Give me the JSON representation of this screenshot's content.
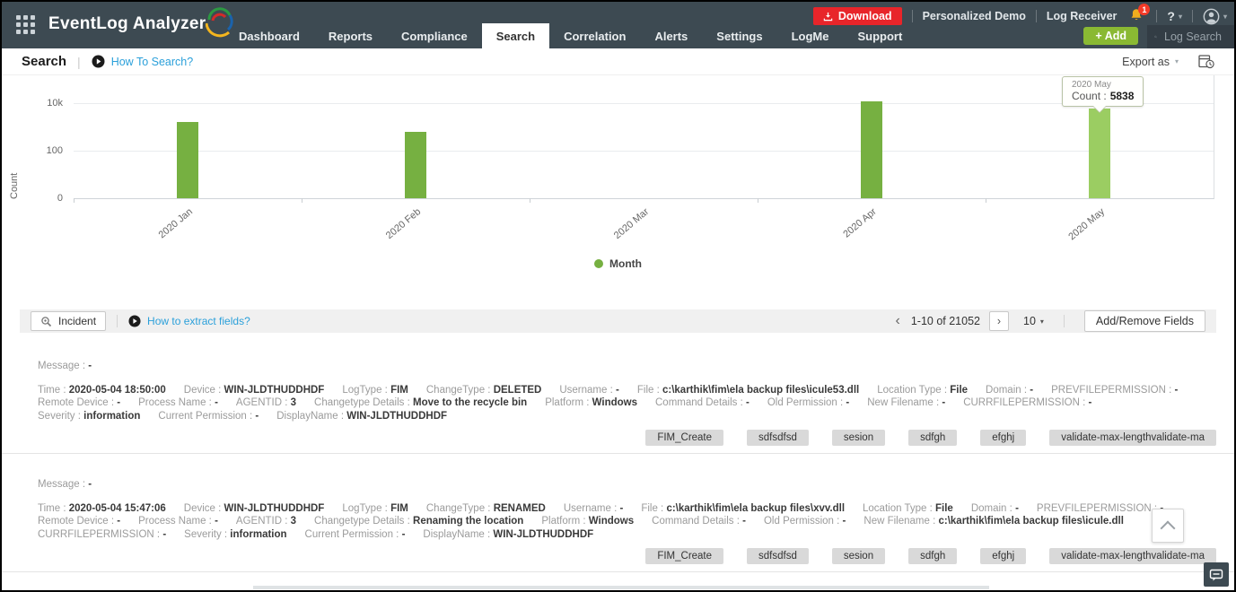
{
  "icons": {
    "chevron_down": "▾",
    "chevron_left": "‹",
    "chevron_right": "›"
  },
  "header": {
    "brand": "EventLog Analyzer",
    "nav": [
      {
        "label": "Dashboard",
        "active": false
      },
      {
        "label": "Reports",
        "active": false
      },
      {
        "label": "Compliance",
        "active": false
      },
      {
        "label": "Search",
        "active": true
      },
      {
        "label": "Correlation",
        "active": false
      },
      {
        "label": "Alerts",
        "active": false
      },
      {
        "label": "Settings",
        "active": false
      },
      {
        "label": "LogMe",
        "active": false
      },
      {
        "label": "Support",
        "active": false
      }
    ],
    "download_label": "Download",
    "personalized_demo_label": "Personalized Demo",
    "log_receiver_label": "Log Receiver",
    "notification_count": "1",
    "help_label": "?",
    "add_button_label": "+ Add",
    "log_search_placeholder": "Log Search",
    "colors": {
      "bar": "#3d4a52",
      "download": "#e8252a",
      "add": "#8ab933"
    }
  },
  "subheader": {
    "title": "Search",
    "help_link": "How To Search?",
    "export_label": "Export as"
  },
  "chart_data": {
    "type": "bar",
    "title": "",
    "xlabel": "Month",
    "ylabel": "Count",
    "categories": [
      "2020 Jan",
      "2020 Feb",
      "2020 Mar",
      "2020 Apr",
      "2020 May"
    ],
    "values": [
      1600,
      600,
      0,
      11500,
      5838
    ],
    "yticks": [
      0,
      100,
      10000
    ],
    "ytick_labels": [
      "0",
      "100",
      "10k"
    ],
    "yscale": "log",
    "grid": true,
    "bar_color": "#76b041",
    "highlight_color": "#9bcd62",
    "highlighted_category": "2020 May",
    "legend": {
      "label": "Month",
      "position": "bottom"
    }
  },
  "chart_tooltip": {
    "title": "2020 May",
    "label": "Count :",
    "value": "5838"
  },
  "results_toolbar": {
    "incident_label": "Incident",
    "extract_link": "How to extract fields?",
    "pagination_text": "1-10 of 21052",
    "page_size": "10",
    "add_remove_label": "Add/Remove Fields"
  },
  "entries": [
    {
      "message": {
        "label": "Message",
        "value": "-"
      },
      "rows": [
        [
          {
            "label": "Time",
            "value": "2020-05-04 18:50:00"
          },
          {
            "label": "Device",
            "value": "WIN-JLDTHUDDHDF"
          },
          {
            "label": "LogType",
            "value": "FIM"
          },
          {
            "label": "ChangeType",
            "value": "DELETED"
          },
          {
            "label": "Username",
            "value": "-"
          },
          {
            "label": "File",
            "value": "c:\\karthik\\fim\\ela backup files\\icule53.dll"
          },
          {
            "label": "Location Type",
            "value": "File"
          },
          {
            "label": "Domain",
            "value": "-"
          },
          {
            "label": "PREVFILEPERMISSION",
            "value": "-"
          }
        ],
        [
          {
            "label": "Remote Device",
            "value": "-"
          },
          {
            "label": "Process Name",
            "value": "-"
          },
          {
            "label": "AGENTID",
            "value": "3"
          },
          {
            "label": "Changetype Details",
            "value": "Move to the recycle bin"
          },
          {
            "label": "Platform",
            "value": "Windows"
          },
          {
            "label": "Command Details",
            "value": "-"
          },
          {
            "label": "Old Permission",
            "value": "-"
          },
          {
            "label": "New Filename",
            "value": "-"
          },
          {
            "label": "CURRFILEPERMISSION",
            "value": "-"
          }
        ],
        [
          {
            "label": "Severity",
            "value": "information"
          },
          {
            "label": "Current Permission",
            "value": "-"
          },
          {
            "label": "DisplayName",
            "value": "WIN-JLDTHUDDHDF"
          }
        ]
      ],
      "tags": [
        "FIM_Create",
        "sdfsdfsd",
        "sesion",
        "sdfgh",
        "efghj",
        "validate-max-lengthvalidate-ma"
      ]
    },
    {
      "message": {
        "label": "Message",
        "value": "-"
      },
      "rows": [
        [
          {
            "label": "Time",
            "value": "2020-05-04 15:47:06"
          },
          {
            "label": "Device",
            "value": "WIN-JLDTHUDDHDF"
          },
          {
            "label": "LogType",
            "value": "FIM"
          },
          {
            "label": "ChangeType",
            "value": "RENAMED"
          },
          {
            "label": "Username",
            "value": "-"
          },
          {
            "label": "File",
            "value": "c:\\karthik\\fim\\ela backup files\\xvv.dll"
          },
          {
            "label": "Location Type",
            "value": "File"
          },
          {
            "label": "Domain",
            "value": "-"
          },
          {
            "label": "PREVFILEPERMISSION",
            "value": "-"
          }
        ],
        [
          {
            "label": "Remote Device",
            "value": "-"
          },
          {
            "label": "Process Name",
            "value": "-"
          },
          {
            "label": "AGENTID",
            "value": "3"
          },
          {
            "label": "Changetype Details",
            "value": "Renaming the location"
          },
          {
            "label": "Platform",
            "value": "Windows"
          },
          {
            "label": "Command Details",
            "value": "-"
          },
          {
            "label": "Old Permission",
            "value": "-"
          },
          {
            "label": "New Filename",
            "value": "c:\\karthik\\fim\\ela backup files\\icule.dll"
          }
        ],
        [
          {
            "label": "CURRFILEPERMISSION",
            "value": "-"
          },
          {
            "label": "Severity",
            "value": "information"
          },
          {
            "label": "Current Permission",
            "value": "-"
          },
          {
            "label": "DisplayName",
            "value": "WIN-JLDTHUDDHDF"
          }
        ]
      ],
      "tags": [
        "FIM_Create",
        "sdfsdfsd",
        "sesion",
        "sdfgh",
        "efghj",
        "validate-max-lengthvalidate-ma"
      ]
    }
  ]
}
